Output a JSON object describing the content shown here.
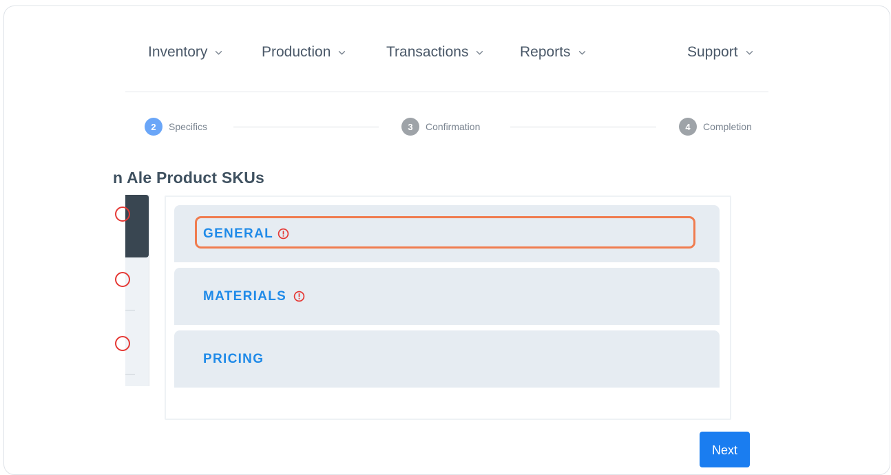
{
  "nav": {
    "items": [
      {
        "label": "Inventory"
      },
      {
        "label": "Production"
      },
      {
        "label": "Transactions"
      },
      {
        "label": "Reports"
      },
      {
        "label": "Support"
      }
    ]
  },
  "stepper": {
    "steps": [
      {
        "number": "2",
        "label": "Specifics",
        "state": "active"
      },
      {
        "number": "3",
        "label": "Confirmation",
        "state": "idle"
      },
      {
        "number": "4",
        "label": "Completion",
        "state": "idle"
      }
    ]
  },
  "page": {
    "heading": "n Ale Product SKUs"
  },
  "sections": [
    {
      "label": "GENERAL",
      "has_error": true
    },
    {
      "label": "MATERIALS",
      "has_error": true
    },
    {
      "label": "PRICING",
      "has_error": false
    }
  ],
  "actions": {
    "next_label": "Next"
  },
  "colors": {
    "accent": "#1a7df0",
    "step_active": "#6aa6f8",
    "error": "#e53935",
    "highlight": "#f07c4f",
    "section_label": "#1f8ae8"
  },
  "icons": {
    "chevron": "chevron-down-icon",
    "error": "error-circle-icon"
  }
}
